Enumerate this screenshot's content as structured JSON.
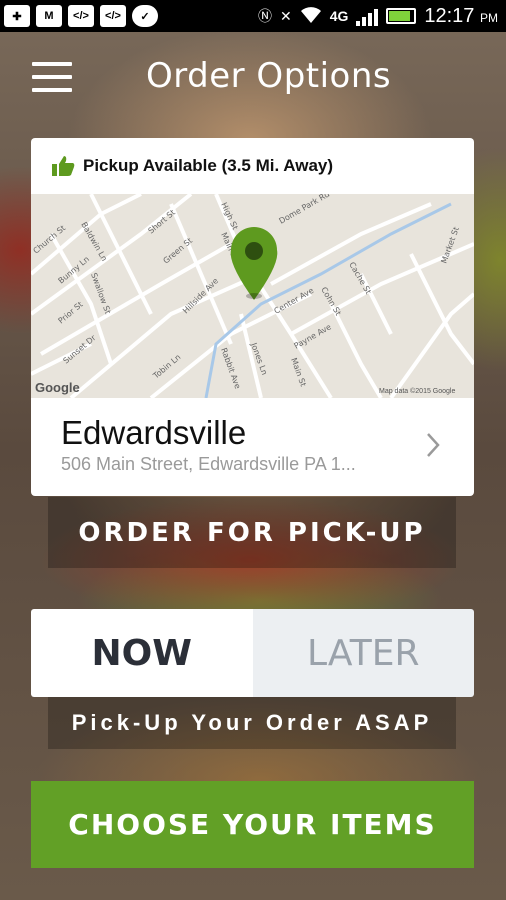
{
  "status_bar": {
    "time": "12:17",
    "ampm": "PM",
    "network": "4G",
    "icons": [
      "plus-icon",
      "gmail-icon",
      "code-icon",
      "code-icon",
      "chat-icon",
      "nfc-icon",
      "mute-icon",
      "wifi-icon",
      "signal-icon",
      "battery-icon"
    ]
  },
  "header": {
    "title": "Order Options",
    "menu_icon": "hamburger-icon"
  },
  "location_card": {
    "availability": "Pickup Available (3.5 Mi. Away)",
    "availability_icon": "thumbs-up-icon",
    "name": "Edwardsville",
    "address": "506 Main Street, Edwardsville PA 1...",
    "map": {
      "google_label": "Google",
      "attribution": "Map data ©2015 Google",
      "street_labels": [
        "Baldwin Ln",
        "Church St",
        "Bunny Ln",
        "Kellie Ln",
        "Swallow St",
        "Prior St",
        "Sunset Dr",
        "Short St",
        "Green St",
        "Hillside Ave",
        "Tobin Ln",
        "Main St",
        "High St",
        "Center Ave",
        "Jones Ln",
        "Rabbit Ave",
        "Dome Park Rd",
        "Cohn St",
        "Cache St",
        "Payne Ave",
        "Main St",
        "Market St"
      ]
    }
  },
  "pickup_button": "ORDER FOR PICK-UP",
  "time_toggle": {
    "now": "NOW",
    "later": "LATER",
    "selected": "NOW"
  },
  "timing_note": "Pick-Up Your Order ASAP",
  "choose_button": "CHOOSE YOUR ITEMS",
  "colors": {
    "accent_green": "#62a026",
    "pin_green": "#5e9a1f",
    "status_bar": "#000000"
  }
}
